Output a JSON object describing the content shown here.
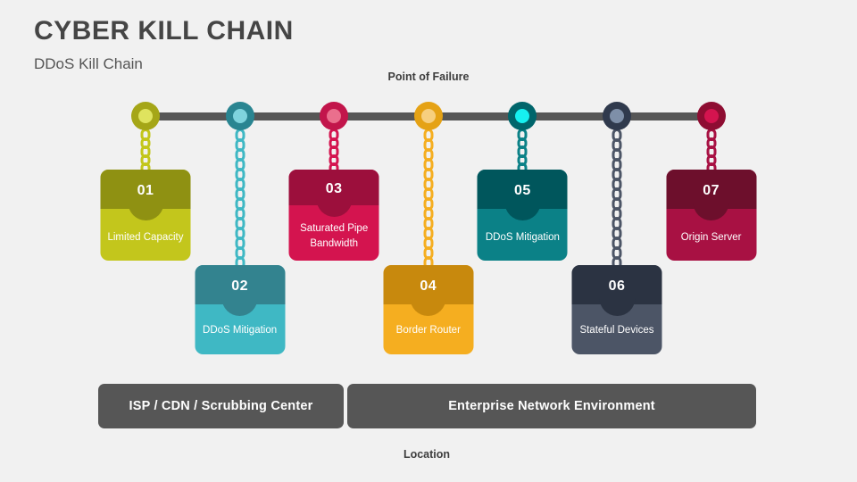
{
  "header": {
    "title": "CYBER KILL CHAIN",
    "subtitle": "DDoS Kill Chain"
  },
  "captions": {
    "point_of_failure": "Point of Failure",
    "location": "Location"
  },
  "theme": {
    "background": "#f1f1f1",
    "rail_color": "#565656",
    "caption_color": "#3d3d3d",
    "title_color": "#454545",
    "locbar_color": "#565656"
  },
  "chart_data": {
    "type": "diagram",
    "title": "CYBER KILL CHAIN",
    "subtitle": "DDoS Kill Chain",
    "steps": [
      {
        "number": "01",
        "label": "Limited Capacity",
        "position": "top",
        "node_ring": "#a5a617",
        "node_core": "#dfe35e",
        "card_top": "#8f9112",
        "card_body": "#c3c61c",
        "chain_color": "#c3c61c"
      },
      {
        "number": "02",
        "label": "DDoS Mitigation",
        "position": "bottom",
        "node_ring": "#2a8591",
        "node_core": "#7fd4dd",
        "card_top": "#33838f",
        "card_body": "#3fb8c4",
        "chain_color": "#3fb8c4"
      },
      {
        "number": "03",
        "label": "Saturated Pipe Bandwidth",
        "position": "top",
        "node_ring": "#c2154b",
        "node_core": "#ea6f8d",
        "card_top": "#9c0f3c",
        "card_body": "#d4144f",
        "chain_color": "#d4144f"
      },
      {
        "number": "04",
        "label": "Border Router",
        "position": "bottom",
        "node_ring": "#e5a215",
        "node_core": "#f7cf7e",
        "card_top": "#c8890d",
        "card_body": "#f5ae20",
        "chain_color": "#f5ae20"
      },
      {
        "number": "05",
        "label": "DDoS Mitigation",
        "position": "top",
        "node_ring": "#00656b",
        "node_core": "#16f0f0",
        "card_top": "#00565c",
        "card_body": "#0b8187",
        "chain_color": "#0b8187"
      },
      {
        "number": "06",
        "label": "Stateful Devices",
        "position": "bottom",
        "node_ring": "#303a4d",
        "node_core": "#7e8fa8",
        "card_top": "#2b3342",
        "card_body": "#4c5566",
        "chain_color": "#4c5566"
      },
      {
        "number": "07",
        "label": "Origin Server",
        "position": "top",
        "node_ring": "#8e0d32",
        "node_core": "#d4144f",
        "card_top": "#6d0f2c",
        "card_body": "#a81143",
        "chain_color": "#a81143"
      }
    ],
    "locations": [
      {
        "label": "ISP / CDN / Scrubbing Center",
        "span": "steps 1-2"
      },
      {
        "label": "Enterprise Network Environment",
        "span": "steps 3-7"
      }
    ]
  }
}
